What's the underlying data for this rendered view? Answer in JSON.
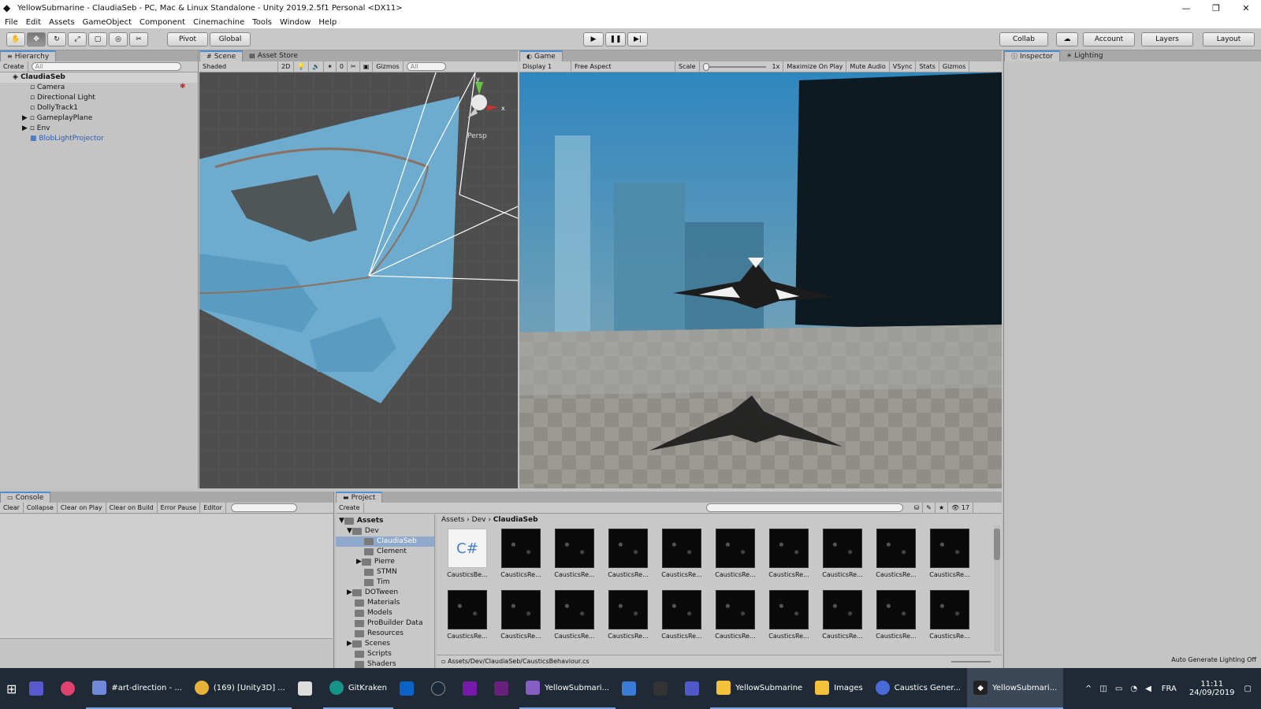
{
  "window": {
    "title": "YellowSubmarine - ClaudiaSeb - PC, Mac & Linux Standalone - Unity 2019.2.5f1 Personal <DX11>",
    "controls": [
      "—",
      "❐",
      "✕"
    ]
  },
  "menu": [
    "File",
    "Edit",
    "Assets",
    "GameObject",
    "Component",
    "Cinemachine",
    "Tools",
    "Window",
    "Help"
  ],
  "toolbar": {
    "pivot": "Pivot",
    "global": "Global",
    "collab": "Collab",
    "account": "Account",
    "layers": "Layers",
    "layout": "Layout"
  },
  "hierarchy": {
    "tab": "Hierarchy",
    "create": "Create",
    "search_placeholder": "All",
    "scene": "ClaudiaSeb",
    "items": [
      "Camera",
      "Directional Light",
      "DollyTrack1",
      "GameplayPlane",
      "Env",
      "BlobLightProjector"
    ]
  },
  "scene": {
    "tabs": [
      "Scene",
      "Asset Store"
    ],
    "shading": "Shaded",
    "mode2d": "2D",
    "hidden_count": "0",
    "gizmos": "Gizmos",
    "search": "All",
    "persp": "Persp",
    "axis_y": "y",
    "axis_x": "x"
  },
  "game": {
    "tab": "Game",
    "display": "Display 1",
    "aspect": "Free Aspect",
    "scale_label": "Scale",
    "scale_value": "1x",
    "maximize": "Maximize On Play",
    "mute": "Mute Audio",
    "vsync": "VSync",
    "stats": "Stats",
    "gizmos": "Gizmos"
  },
  "inspector": {
    "tabs": [
      "Inspector",
      "Lighting"
    ]
  },
  "console": {
    "tab": "Console",
    "buttons": [
      "Clear",
      "Collapse",
      "Clear on Play",
      "Clear on Build",
      "Error Pause",
      "Editor"
    ]
  },
  "project": {
    "tab": "Project",
    "create": "Create",
    "filter_count": "17",
    "tree": [
      {
        "label": "Assets",
        "level": 0,
        "bold": true
      },
      {
        "label": "Dev",
        "level": 1
      },
      {
        "label": "ClaudiaSeb",
        "level": 2,
        "selected": true
      },
      {
        "label": "Clement",
        "level": 2
      },
      {
        "label": "Pierre",
        "level": 2
      },
      {
        "label": "STMN",
        "level": 2
      },
      {
        "label": "Tim",
        "level": 2
      },
      {
        "label": "DOTween",
        "level": 1
      },
      {
        "label": "Materials",
        "level": 1
      },
      {
        "label": "Models",
        "level": 1
      },
      {
        "label": "ProBuilder Data",
        "level": 1
      },
      {
        "label": "Resources",
        "level": 1
      },
      {
        "label": "Scenes",
        "level": 1
      },
      {
        "label": "Scripts",
        "level": 1
      },
      {
        "label": "Shaders",
        "level": 1
      }
    ],
    "breadcrumb": [
      "Assets",
      "Dev",
      "ClaudiaSeb"
    ],
    "assets_row1": [
      "CausticsBe...",
      "CausticsRe...",
      "CausticsRe...",
      "CausticsRe...",
      "CausticsRe...",
      "CausticsRe...",
      "CausticsRe...",
      "CausticsRe...",
      "CausticsRe...",
      "CausticsRe..."
    ],
    "assets_row2": [
      "CausticsRe...",
      "CausticsRe...",
      "CausticsRe...",
      "CausticsRe...",
      "CausticsRe...",
      "CausticsRe...",
      "CausticsRe...",
      "CausticsRe...",
      "CausticsRe...",
      "CausticsRe..."
    ],
    "cs_icon": "C#",
    "path": "Assets/Dev/ClaudiaSeb/CausticsBehaviour.cs"
  },
  "statusbar": {
    "lighting": "Auto Generate Lighting Off"
  },
  "taskbar": {
    "items": [
      "#art-direction - ...",
      "(169) [Unity3D] ...",
      "GitKraken",
      "YellowSubmari...",
      "YellowSubmarine",
      "Images",
      "Caustics Gener...",
      "YellowSubmari..."
    ],
    "lang": "FRA",
    "time": "11:11",
    "date": "24/09/2019"
  },
  "colors": {
    "accent": "#4a90d9",
    "panel": "#c2c2c2",
    "scene_water": "#6fb0d6",
    "game_sky": "#3a8cc0",
    "taskbar": "#1f2a36"
  }
}
